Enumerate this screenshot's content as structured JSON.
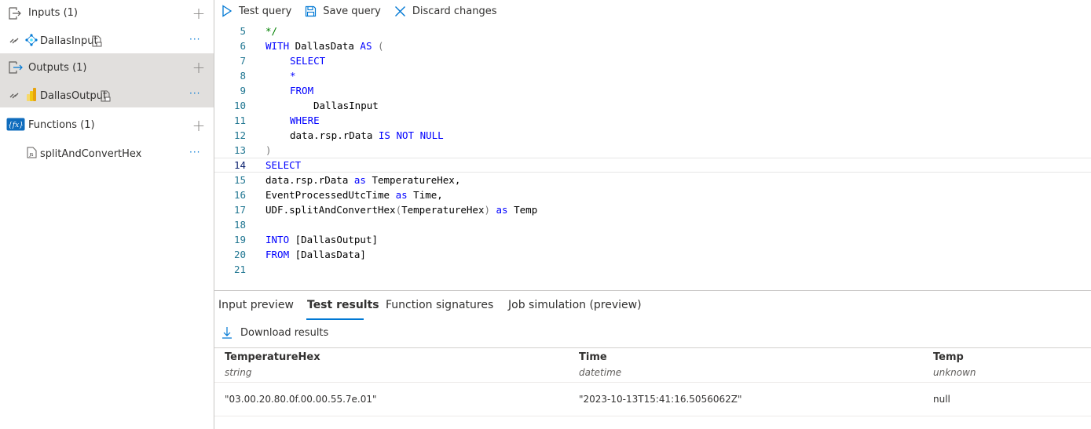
{
  "sidebar": {
    "inputs_label": "Inputs (1)",
    "input_item": "DallasInput",
    "outputs_label": "Outputs (1)",
    "output_item": "DallasOutput",
    "functions_label": "Functions (1)",
    "function_item": "splitAndConvertHex",
    "more_label": "···",
    "add_label": "+"
  },
  "toolbar": {
    "test_query": "Test query",
    "save_query": "Save query",
    "discard_changes": "Discard changes"
  },
  "editor": {
    "lines": [
      {
        "n": "5"
      },
      {
        "n": "6"
      },
      {
        "n": "7"
      },
      {
        "n": "8"
      },
      {
        "n": "9"
      },
      {
        "n": "10"
      },
      {
        "n": "11"
      },
      {
        "n": "12"
      },
      {
        "n": "13"
      },
      {
        "n": "14"
      },
      {
        "n": "15"
      },
      {
        "n": "16"
      },
      {
        "n": "17"
      },
      {
        "n": "18"
      },
      {
        "n": "19"
      },
      {
        "n": "20"
      },
      {
        "n": "21"
      }
    ],
    "t": {
      "comment_end": "*/",
      "with": "WITH",
      "cte_name": " DallasData ",
      "as": "as",
      "AS": "AS",
      "paren_open": " (",
      "select": "SELECT",
      "star": "*",
      "from": "FROM",
      "dallas_input": "DallasInput",
      "where": "WHERE",
      "rdata": "data.rsp.rData ",
      "is_not_null": "IS NOT NULL",
      "paren_close": ")",
      "line15a": "data.rsp.rData ",
      "line15b": " TemperatureHex,",
      "line16a": "EventProcessedUtcTime ",
      "line16b": " Time,",
      "line17a": "UDF.splitAndConvertHex",
      "line17b": "(",
      "line17c": "TemperatureHex",
      "line17d": ")",
      "line17e": " Temp",
      "into": "INTO",
      "into_target": " [DallasOutput]",
      "from_target": " [DallasData]"
    }
  },
  "tabs": [
    {
      "label": "Input preview"
    },
    {
      "label": "Test results"
    },
    {
      "label": "Function signatures"
    },
    {
      "label": "Job simulation (preview)"
    }
  ],
  "download_label": "Download results",
  "results": {
    "columns": [
      {
        "name": "TemperatureHex",
        "type": "string"
      },
      {
        "name": "Time",
        "type": "datetime"
      },
      {
        "name": "Temp",
        "type": "unknown"
      }
    ],
    "rows": [
      [
        "\"03.00.20.80.0f.00.00.55.7e.01\"",
        "\"2023-10-13T15:41:16.5056062Z\"",
        "null"
      ]
    ]
  },
  "colors": {
    "keyword": "#0000ff",
    "comment": "#008000",
    "line_number": "#237893",
    "accent": "#0078d4",
    "selected_row": "#e1dfdd"
  }
}
